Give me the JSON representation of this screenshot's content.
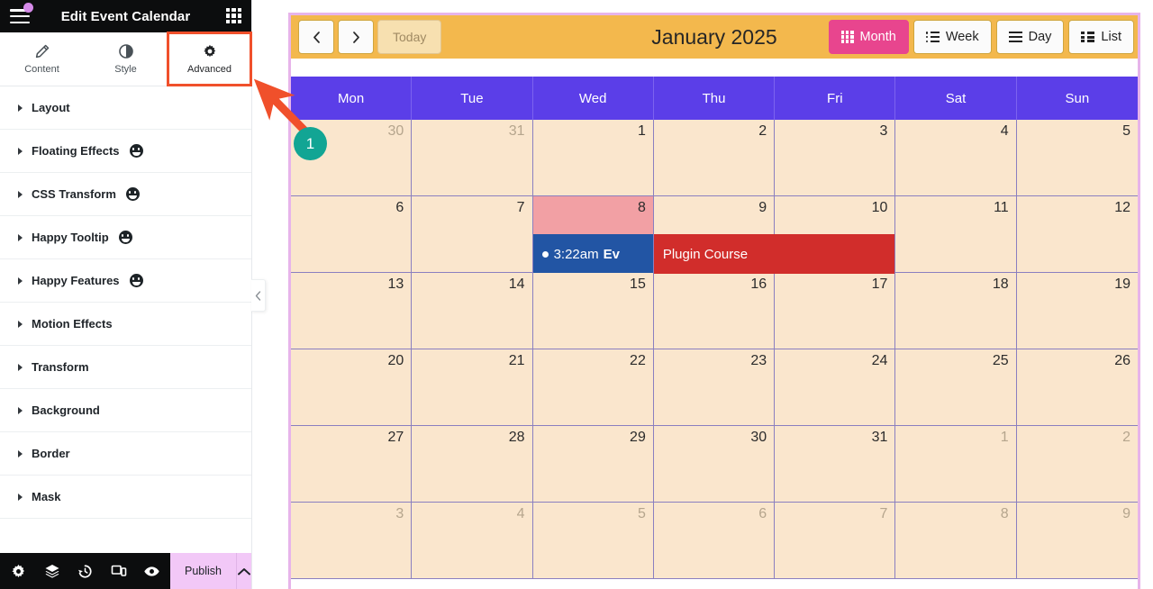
{
  "panel": {
    "title": "Edit Event Calendar",
    "menu_icon": "hamburger-icon",
    "apps_icon": "grid-apps-icon",
    "tabs": [
      {
        "label": "Content",
        "icon": "pencil-icon",
        "active": false
      },
      {
        "label": "Style",
        "icon": "contrast-icon",
        "active": false
      },
      {
        "label": "Advanced",
        "icon": "gear-icon",
        "active": true
      }
    ],
    "sections": [
      {
        "label": "Layout",
        "pro": false
      },
      {
        "label": "Floating Effects",
        "pro": true
      },
      {
        "label": "CSS Transform",
        "pro": true
      },
      {
        "label": "Happy Tooltip",
        "pro": true
      },
      {
        "label": "Happy Features",
        "pro": true
      },
      {
        "label": "Motion Effects",
        "pro": false
      },
      {
        "label": "Transform",
        "pro": false
      },
      {
        "label": "Background",
        "pro": false
      },
      {
        "label": "Border",
        "pro": false
      },
      {
        "label": "Mask",
        "pro": false
      }
    ],
    "footer": {
      "icons": [
        "gear-icon",
        "layers-icon",
        "history-icon",
        "responsive-icon",
        "preview-eye-icon"
      ],
      "publish_label": "Publish",
      "publish_more_icon": "chevron-up-icon"
    },
    "collapse_icon": "chevron-left-icon"
  },
  "calendar": {
    "toolbar": {
      "prev_icon": "chevron-left-icon",
      "next_icon": "chevron-right-icon",
      "today_label": "Today",
      "title": "January 2025",
      "views": [
        {
          "label": "Month",
          "icon": "grid-icon",
          "active": true
        },
        {
          "label": "Week",
          "icon": "list-icon",
          "active": false
        },
        {
          "label": "Day",
          "icon": "bars-icon",
          "active": false
        },
        {
          "label": "List",
          "icon": "table-icon",
          "active": false
        }
      ]
    },
    "day_names": [
      "Mon",
      "Tue",
      "Wed",
      "Thu",
      "Fri",
      "Sat",
      "Sun"
    ],
    "weeks": [
      [
        {
          "num": "30",
          "other": true
        },
        {
          "num": "31",
          "other": true
        },
        {
          "num": "1"
        },
        {
          "num": "2"
        },
        {
          "num": "3"
        },
        {
          "num": "4"
        },
        {
          "num": "5"
        }
      ],
      [
        {
          "num": "6"
        },
        {
          "num": "7"
        },
        {
          "num": "8",
          "today": true,
          "event": {
            "type": "blue",
            "time": "3:22am",
            "title": "Ev",
            "span": 1
          }
        },
        {
          "num": "9",
          "event": {
            "type": "red",
            "title": "Plugin Course",
            "span": 2
          }
        },
        {
          "num": "10"
        },
        {
          "num": "11"
        },
        {
          "num": "12"
        }
      ],
      [
        {
          "num": "13"
        },
        {
          "num": "14"
        },
        {
          "num": "15"
        },
        {
          "num": "16"
        },
        {
          "num": "17"
        },
        {
          "num": "18"
        },
        {
          "num": "19"
        }
      ],
      [
        {
          "num": "20"
        },
        {
          "num": "21"
        },
        {
          "num": "22"
        },
        {
          "num": "23"
        },
        {
          "num": "24"
        },
        {
          "num": "25"
        },
        {
          "num": "26"
        }
      ],
      [
        {
          "num": "27"
        },
        {
          "num": "28"
        },
        {
          "num": "29"
        },
        {
          "num": "30"
        },
        {
          "num": "31"
        },
        {
          "num": "1",
          "other": true
        },
        {
          "num": "2",
          "other": true
        }
      ],
      [
        {
          "num": "3",
          "other": true
        },
        {
          "num": "4",
          "other": true
        },
        {
          "num": "5",
          "other": true
        },
        {
          "num": "6",
          "other": true
        },
        {
          "num": "7",
          "other": true
        },
        {
          "num": "8",
          "other": true
        },
        {
          "num": "9",
          "other": true
        }
      ]
    ]
  },
  "annotation": {
    "step_number": "1",
    "arrow_color": "#f0502b",
    "badge_color": "#12a594"
  },
  "colors": {
    "accent_orange": "#f0502b",
    "header_purple": "#5b3ee8",
    "toolbar_amber": "#f3b84d",
    "active_view_pink": "#e8458e",
    "cell_cream": "#fae6cd",
    "today_salmon": "#f2a0a4",
    "event_blue": "#2255a4",
    "event_red": "#d12d2b",
    "publish_lavender": "#f2c8f7"
  }
}
